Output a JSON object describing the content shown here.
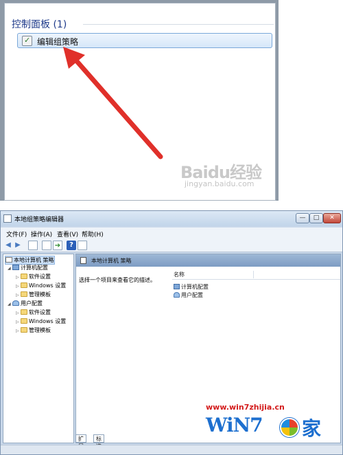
{
  "search_results": {
    "group_title": "控制面板 (1)",
    "result_label": "编辑组策略"
  },
  "watermark_top": {
    "brand": "Baidu经验",
    "url": "jingyan.baidu.com"
  },
  "window": {
    "title": "本地组策略编辑器",
    "buttons": {
      "minimize": "—",
      "maximize": "□",
      "close": "✕"
    },
    "menu": [
      "文件(F)",
      "操作(A)",
      "查看(V)",
      "帮助(H)"
    ],
    "toolbar": [
      "back-icon",
      "forward-icon",
      "show-hide-tree-icon",
      "properties-icon",
      "export-icon",
      "help-icon",
      "filter-icon"
    ],
    "tree": {
      "root": "本地计算机 策略",
      "computer": "计算机配置",
      "computer_children": [
        "软件设置",
        "Windows 设置",
        "管理模板"
      ],
      "user": "用户配置",
      "user_children": [
        "软件设置",
        "Windows 设置",
        "管理模板"
      ]
    },
    "content": {
      "header": "本地计算机 策略",
      "description": "选择一个项目来查看它的描述。",
      "column_name": "名称",
      "items": [
        "计算机配置",
        "用户配置"
      ]
    },
    "tabs": [
      "扩展",
      "标准"
    ]
  },
  "watermark_bottom": {
    "url": "www.win7zhijia.cn",
    "logo_text": "WiN7",
    "logo_suffix": "家"
  },
  "colors": {
    "accent_arrow": "#e0302a",
    "title_blue": "#1e3a8a",
    "watermark_red": "#d31b1b",
    "logo_blue": "#1d6fcf"
  }
}
